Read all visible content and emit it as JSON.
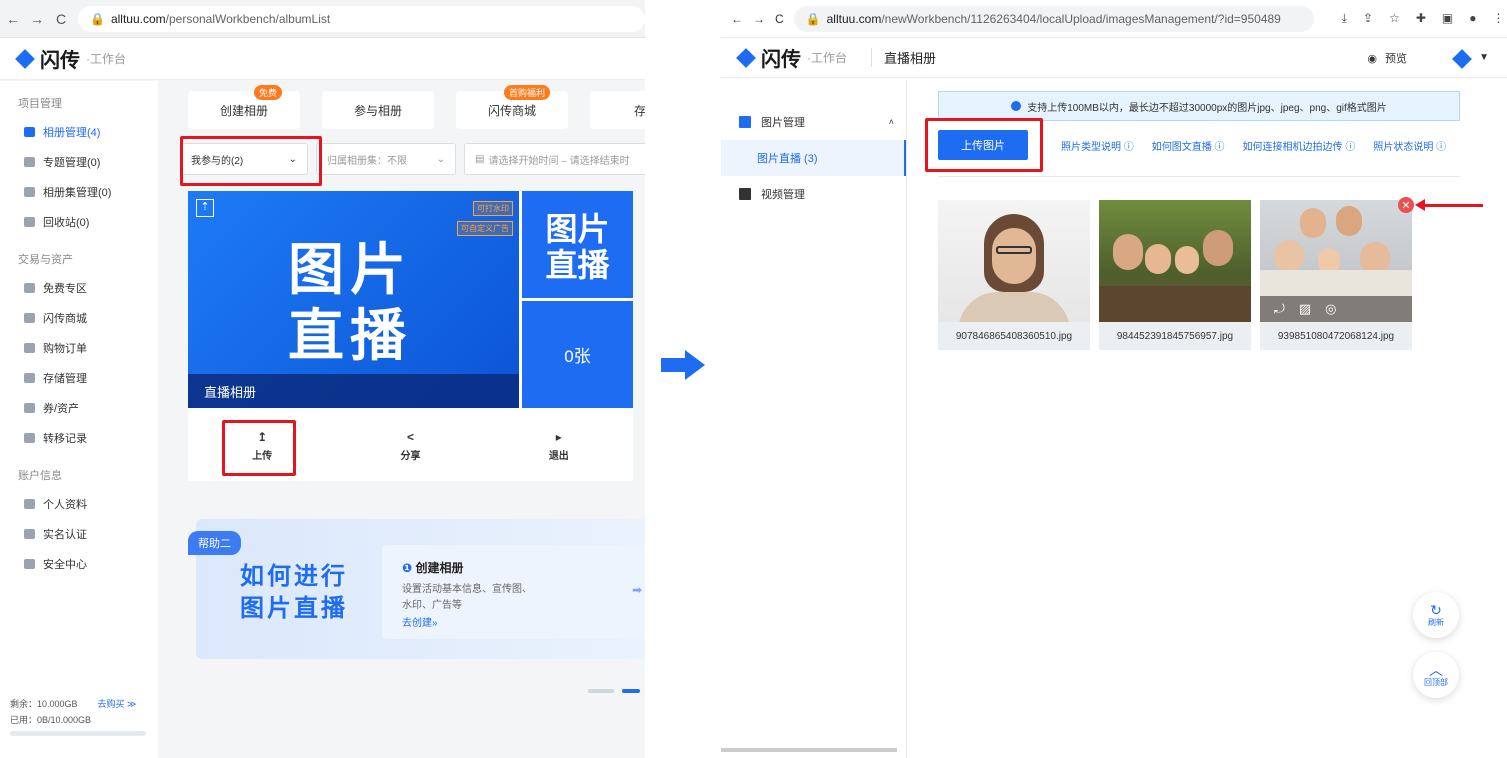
{
  "left": {
    "url_host": "alltuu.com",
    "url_path": "/personalWorkbench/albumList",
    "logo_name": "闪传",
    "logo_sub": "·工作台",
    "sidebar": [
      {
        "section": "项目管理",
        "items": [
          {
            "label": "相册管理(4)",
            "active": true
          },
          {
            "label": "专题管理(0)"
          },
          {
            "label": "相册集管理(0)"
          },
          {
            "label": "回收站(0)"
          }
        ]
      },
      {
        "section": "交易与资产",
        "items": [
          {
            "label": "免费专区"
          },
          {
            "label": "闪传商城"
          },
          {
            "label": "购物订单"
          },
          {
            "label": "存储管理"
          },
          {
            "label": "券/资产"
          },
          {
            "label": "转移记录"
          }
        ]
      },
      {
        "section": "账户信息",
        "items": [
          {
            "label": "个人资料"
          },
          {
            "label": "实名认证"
          },
          {
            "label": "安全中心"
          }
        ]
      }
    ],
    "storage": {
      "remaining": "剩余：10.000GB",
      "buy": "去购买 ≫",
      "used": "已用：0B/10.000GB"
    },
    "tabs": [
      {
        "label": "创建相册",
        "badge": "免费"
      },
      {
        "label": "参与相册"
      },
      {
        "label": "闪传商城",
        "badge": "首购福利"
      },
      {
        "label": "存储"
      }
    ],
    "filters": {
      "mine": "我参与的(2)",
      "album_set": "归属相册集：不限",
      "date": "请选择开始时间 – 请选择结束时"
    },
    "card": {
      "cover_text1": "图片",
      "cover_text2": "直播",
      "tag1": "可打水印",
      "tag2": "可自定义广告",
      "caption": "直播相册",
      "side_text1": "图片",
      "side_text2": "直播",
      "count": "0张",
      "actions": [
        {
          "label": "上传",
          "icon": "↥"
        },
        {
          "label": "分享",
          "icon": "<"
        },
        {
          "label": "退出",
          "icon": "▸"
        }
      ]
    },
    "help": {
      "tag": "帮助二",
      "line1": "如何进行",
      "line2": "图片直播",
      "step_title": "创建相册",
      "step_desc1": "设置活动基本信息、宣传图、",
      "step_desc2": "水印、广告等",
      "step_link": "去创建»"
    }
  },
  "right": {
    "url_host": "alltuu.com",
    "url_path": "/newWorkbench/1126263404/localUpload/imagesManagement/?id=950489",
    "logo_name": "闪传",
    "logo_sub": "·工作台",
    "title": "直播相册",
    "preview": "预览",
    "nav": [
      {
        "label": "图片管理"
      },
      {
        "label": "图片直播 (3)",
        "selected": true
      },
      {
        "label": "视频管理"
      }
    ],
    "notice": "支持上传100MB以内，最长边不超过30000px的图片jpg、jpeg、png、gif格式图片",
    "upload_button": "上传图片",
    "links": [
      "照片类型说明 ⓘ",
      "如何图文直播 ⓘ",
      "如何连接相机边拍边传 ⓘ",
      "照片状态说明 ⓘ"
    ],
    "photos": [
      {
        "name": "907846865408360510.jpg"
      },
      {
        "name": "984452391845756957.jpg"
      },
      {
        "name": "939851080472068124.jpg"
      }
    ],
    "refresh": "刷新",
    "back_top": "回顶部"
  },
  "colors": {
    "accent": "#1e6cf2",
    "highlight": "#e5141f",
    "badge": "#ff7a1a"
  }
}
